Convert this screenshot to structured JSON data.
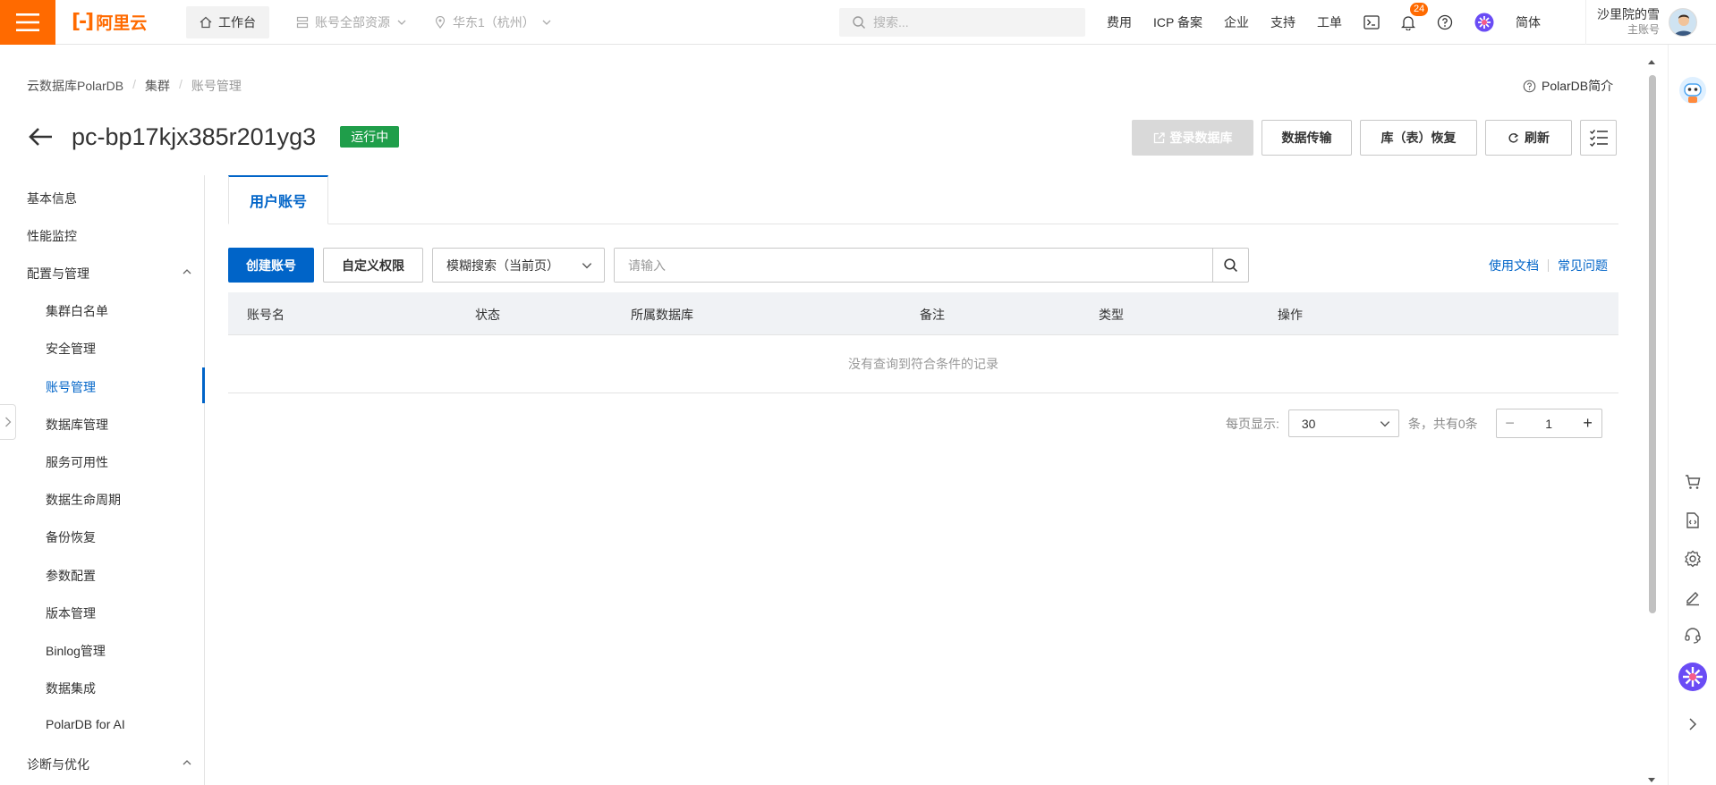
{
  "topbar": {
    "logo_text": "阿里云",
    "workbench": "工作台",
    "resource_scope": "账号全部资源",
    "region": "华东1（杭州）",
    "search_placeholder": "搜索...",
    "links": [
      "费用",
      "ICP 备案",
      "企业",
      "支持",
      "工单"
    ],
    "notification_count": "24",
    "language": "简体",
    "user_name": "沙里院的雪",
    "user_role": "主账号"
  },
  "breadcrumb": [
    "云数据库PolarDB",
    "集群",
    "账号管理"
  ],
  "help_link": "PolarDB简介",
  "header": {
    "title": "pc-bp17kjx385r201yg3",
    "status": "运行中",
    "buttons": {
      "login_db": "登录数据库",
      "data_transfer": "数据传输",
      "restore": "库（表）恢复",
      "refresh": "刷新"
    }
  },
  "sidenav": {
    "top_items": [
      "基本信息",
      "性能监控"
    ],
    "group_config": "配置与管理",
    "config_items": [
      "集群白名单",
      "安全管理",
      "账号管理",
      "数据库管理",
      "服务可用性",
      "数据生命周期",
      "备份恢复",
      "参数配置",
      "版本管理",
      "Binlog管理",
      "数据集成",
      "PolarDB for AI"
    ],
    "active_index": 2,
    "group_diagnose": "诊断与优化"
  },
  "tabs": [
    "用户账号"
  ],
  "toolbar": {
    "create_account": "创建账号",
    "custom_permission": "自定义权限",
    "search_mode": "模糊搜索（当前页）",
    "search_placeholder": "请输入",
    "doc_link": "使用文档",
    "faq_link": "常见问题"
  },
  "table": {
    "columns": [
      "账号名",
      "状态",
      "所属数据库",
      "备注",
      "类型",
      "操作"
    ],
    "rows": [],
    "empty_text": "没有查询到符合条件的记录"
  },
  "pagination": {
    "page_size_label": "每页显示:",
    "page_size": "30",
    "total_text": "条，共有0条",
    "current_page": "1"
  },
  "colors": {
    "brand_orange": "#ff6a00",
    "primary_blue": "#0064c8",
    "status_green": "#1f9e4a"
  }
}
